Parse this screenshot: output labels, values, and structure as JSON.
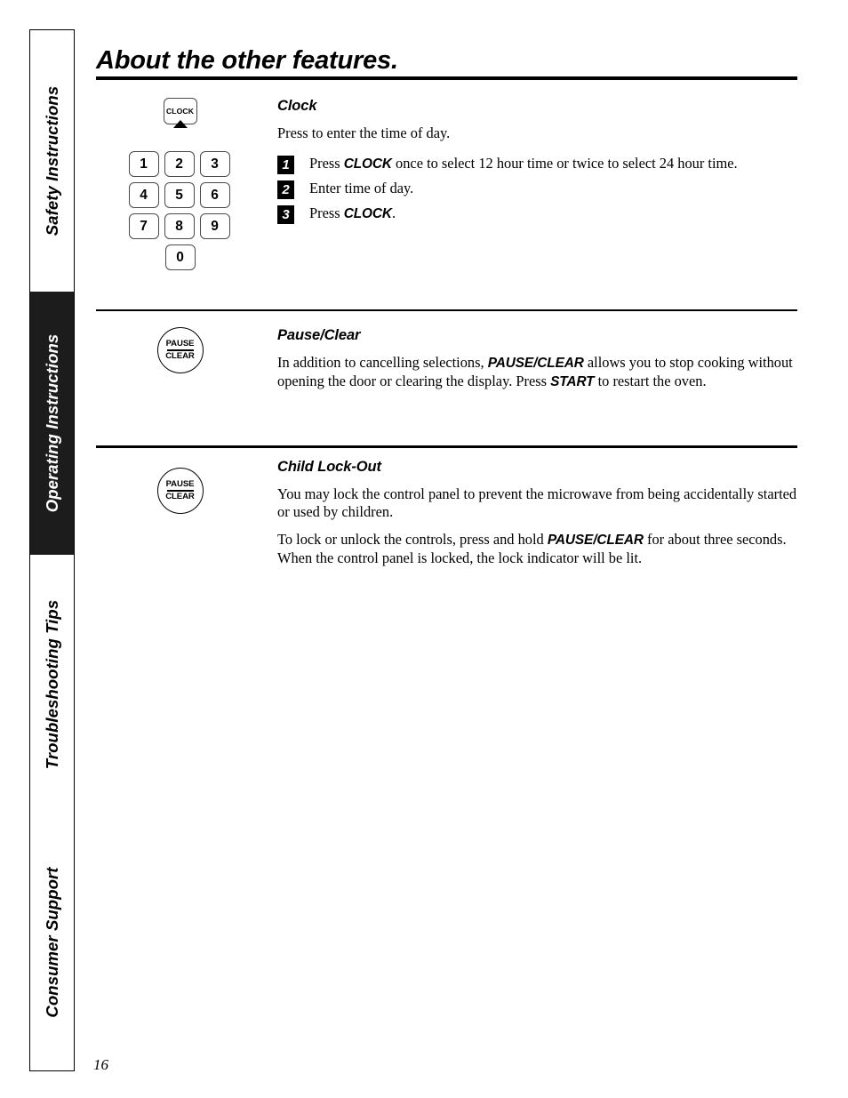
{
  "page": {
    "title": "About the other features.",
    "number": "16"
  },
  "sidebar": {
    "tabs": [
      {
        "label": "Safety Instructions",
        "active": false
      },
      {
        "label": "Operating Instructions",
        "active": true
      },
      {
        "label": "Troubleshooting Tips",
        "active": false
      },
      {
        "label": "Consumer Support",
        "active": false
      }
    ]
  },
  "keypad": {
    "clock_key_label": "CLOCK",
    "rows": [
      [
        "1",
        "2",
        "3"
      ],
      [
        "4",
        "5",
        "6"
      ],
      [
        "7",
        "8",
        "9"
      ]
    ],
    "zero_key": "0"
  },
  "pause_clear_key": {
    "top_label": "PAUSE",
    "bottom_label": "CLEAR"
  },
  "sections": {
    "clock": {
      "heading": "Clock",
      "intro": "Press to enter the time of day.",
      "steps": [
        {
          "number": "1",
          "parts": [
            {
              "text": "Press ",
              "bold": false
            },
            {
              "text": "CLOCK",
              "bold": true
            },
            {
              "text": " once to select 12 hour time or twice to select 24 hour time.",
              "bold": false
            }
          ],
          "plain": "Press CLOCK once to select 12 hour time or twice to select 24 hour time."
        },
        {
          "number": "2",
          "parts": [
            {
              "text": "Enter time of day.",
              "bold": false
            }
          ],
          "plain": "Enter time of day."
        },
        {
          "number": "3",
          "parts": [
            {
              "text": "Press ",
              "bold": false
            },
            {
              "text": "CLOCK",
              "bold": true
            },
            {
              "text": ".",
              "bold": false
            }
          ],
          "plain": "Press CLOCK."
        }
      ]
    },
    "pause_clear": {
      "heading": "Pause/Clear",
      "paragraph_1_a": "In addition to cancelling selections, ",
      "paragraph_1_b": "PAUSE/CLEAR",
      "paragraph_1_c": " allows you to stop cooking without opening the door or clearing the display. Press ",
      "paragraph_1_d": "START",
      "paragraph_1_e": " to restart the oven."
    },
    "child_lock_out": {
      "heading": "Child Lock-Out",
      "paragraph_1": "You may lock the control panel to prevent the microwave from being accidentally started or used by children.",
      "paragraph_2_a": "To lock or unlock the controls, press and hold ",
      "paragraph_2_b": "PAUSE/CLEAR",
      "paragraph_2_c": " for about three seconds. When the control panel is locked, the lock indicator will be lit."
    }
  }
}
